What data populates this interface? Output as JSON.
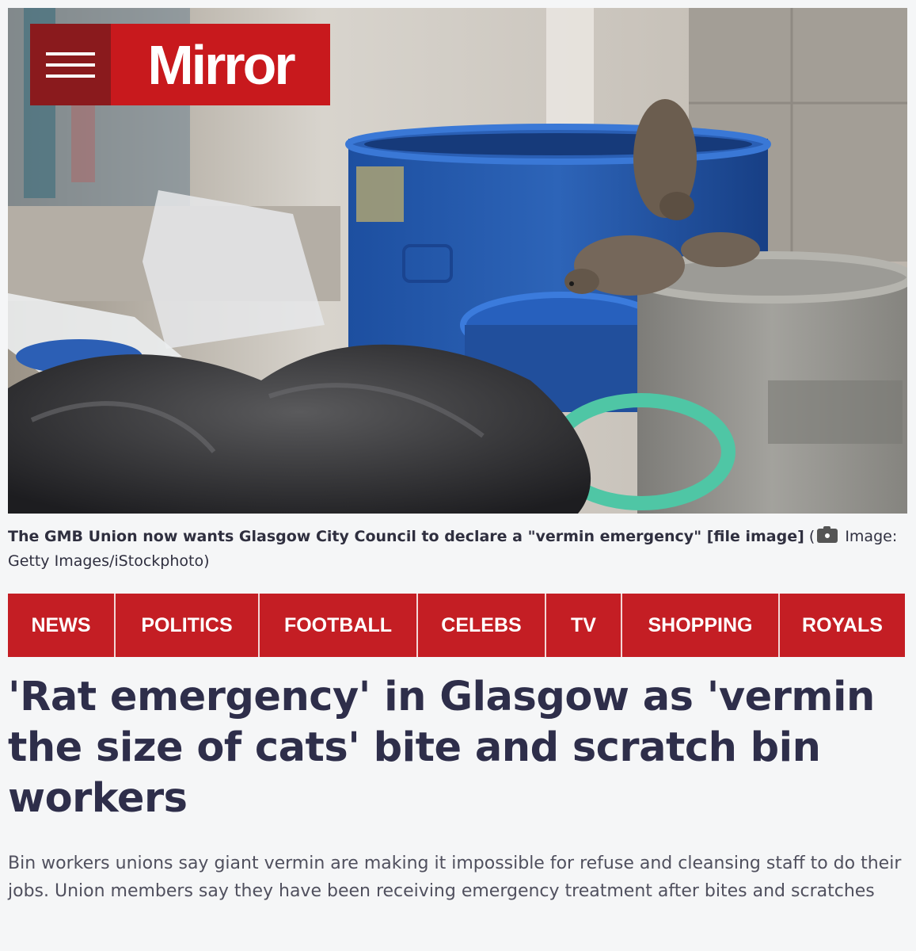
{
  "masthead": {
    "logo_text": "Mirror",
    "menu_icon": "hamburger-menu-icon",
    "brand_color": "#c8191d"
  },
  "hero_image": {
    "description_icon": "photo"
  },
  "caption": {
    "text": "The GMB Union now wants Glasgow City Council to declare a \"vermin emergency\" [file image]",
    "open_paren": "(",
    "camera_icon": "camera-icon",
    "image_label": "Image:",
    "credit": "Getty Images/iStockphoto)"
  },
  "nav": {
    "items": [
      "NEWS",
      "POLITICS",
      "FOOTBALL",
      "CELEBS",
      "TV",
      "SHOPPING",
      "ROYALS"
    ],
    "color": "#c41e24"
  },
  "article": {
    "headline": "'Rat emergency' in Glasgow as 'vermin the size of cats' bite and scratch bin workers",
    "standfirst": "Bin workers unions say giant vermin are making it impossible for refuse and cleansing staff to do their jobs. Union members say they have been receiving emergency treatment after bites and scratches"
  }
}
